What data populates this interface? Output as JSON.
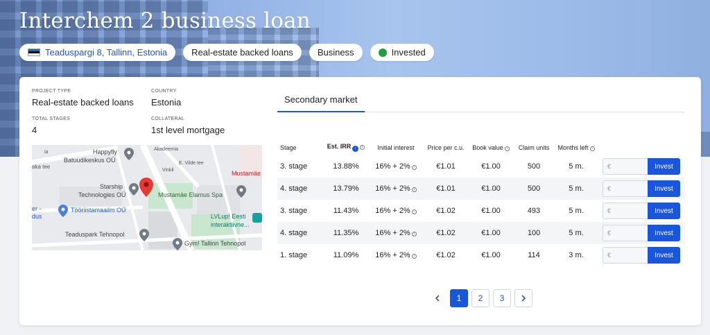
{
  "title": "Interchem 2 business loan",
  "chips": {
    "location": "Teaduspargi 8, Tallinn, Estonia",
    "type": "Real-estate backed loans",
    "category": "Business",
    "status": "Invested"
  },
  "colors": {
    "accent": "#1a56db",
    "status_green": "#1f9d3f"
  },
  "info": {
    "project_type_label": "PROJECT TYPE",
    "project_type": "Real-estate backed loans",
    "country_label": "COUNTRY",
    "country": "Estonia",
    "total_stages_label": "TOTAL STAGES",
    "total_stages": "4",
    "collateral_label": "COLLATERAL",
    "collateral": "1st level mortgage"
  },
  "map": {
    "labels": [
      "Happyfly",
      "Batuudikeskus OÜ",
      "Starship",
      "Technologies OÜ",
      "Mustamäe Elamus Spa",
      "Mustamäe",
      "Tööriistamaailm OÜ",
      "LVLup! Eesti",
      "interaktiivne...",
      "Teaduspark Tehnopol",
      "Gym! Tallinn Tehnopol",
      "aka tee",
      "E. Vilde tee",
      "Akadeemia",
      "Vinkli",
      "ia",
      "er -",
      "dus"
    ]
  },
  "tabs": {
    "secondary": "Secondary market"
  },
  "table": {
    "headers": {
      "stage": "Stage",
      "irr": "Est. IRR",
      "initial_interest": "Initial interest",
      "price": "Price per c.u.",
      "book_value": "Book value",
      "claim_units": "Claim units",
      "months_left": "Months left"
    },
    "rows": [
      {
        "stage": "3. stage",
        "irr": "13.88%",
        "interest": "16% + 2%",
        "price": "€1.01",
        "book": "€1.00",
        "units": "500",
        "months": "5 m."
      },
      {
        "stage": "4. stage",
        "irr": "13.79%",
        "interest": "16% + 2%",
        "price": "€1.01",
        "book": "€1.00",
        "units": "500",
        "months": "5 m."
      },
      {
        "stage": "3. stage",
        "irr": "11.43%",
        "interest": "16% + 2%",
        "price": "€1.02",
        "book": "€1.00",
        "units": "493",
        "months": "5 m."
      },
      {
        "stage": "4. stage",
        "irr": "11.35%",
        "interest": "16% + 2%",
        "price": "€1.02",
        "book": "€1.00",
        "units": "100",
        "months": "5 m."
      },
      {
        "stage": "1. stage",
        "irr": "11.09%",
        "interest": "16% + 2%",
        "price": "€1.02",
        "book": "€1.00",
        "units": "114",
        "months": "3 m."
      }
    ],
    "input_placeholder": "€",
    "invest_label": "Invest"
  },
  "pagination": {
    "pages": [
      "1",
      "2",
      "3"
    ],
    "current": "1"
  }
}
